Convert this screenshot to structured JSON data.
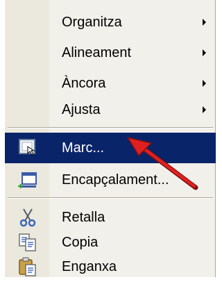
{
  "menu": {
    "items": [
      {
        "label": "Organitza",
        "submenu": true
      },
      {
        "label": "Alineament",
        "submenu": true
      },
      {
        "label": "Àncora",
        "submenu": true
      },
      {
        "label": "Ajusta",
        "submenu": true
      },
      {
        "label": "Marc...",
        "icon": "frame-icon",
        "selected": true
      },
      {
        "label": "Encapçalament...",
        "icon": "header-icon"
      },
      {
        "label": "Retalla",
        "icon": "scissors-icon"
      },
      {
        "label": "Copia",
        "icon": "copy-icon"
      },
      {
        "label": "Enganxa",
        "icon": "paste-icon"
      }
    ]
  },
  "colors": {
    "menu_bg": "#f2f0ea",
    "selection": "#0a246a",
    "annotation_arrow": "#e02020"
  }
}
